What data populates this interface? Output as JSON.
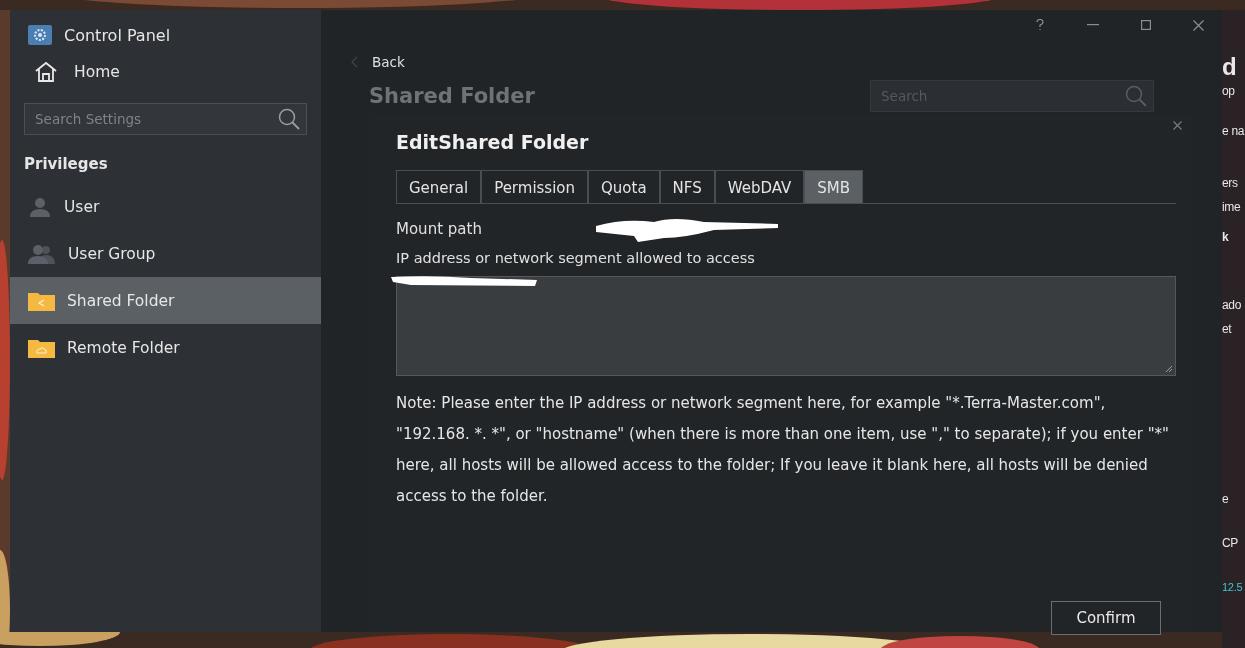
{
  "window": {
    "title": "Control Panel"
  },
  "sidebar": {
    "home": "Home",
    "search": {
      "placeholder": "Search Settings"
    },
    "section": "Privileges",
    "items": [
      {
        "label": "User",
        "selected": false
      },
      {
        "label": "User Group",
        "selected": false
      },
      {
        "label": "Shared Folder",
        "selected": true
      },
      {
        "label": "Remote Folder",
        "selected": false
      }
    ]
  },
  "main": {
    "back": "Back",
    "heading": "Shared Folder",
    "search": {
      "placeholder": "Search"
    }
  },
  "dialog": {
    "title": "EditShared Folder",
    "tabs": [
      {
        "label": "General",
        "selected": false
      },
      {
        "label": "Permission",
        "selected": false
      },
      {
        "label": "Quota",
        "selected": false
      },
      {
        "label": "NFS",
        "selected": false
      },
      {
        "label": "WebDAV",
        "selected": false
      },
      {
        "label": "SMB",
        "selected": true
      }
    ],
    "mount_path_label": "Mount path",
    "ip_label": "IP address or network segment allowed to access",
    "note": "Note: Please enter the IP address or network segment here, for example \"*.Terra-Master.com\", \"192.168. *. *\", or \"hostname\" (when there is more than one item, use \",\" to separate); if you enter \"*\" here, all hosts will be allowed access to the folder; If you leave it blank here, all hosts will be denied access to the folder.",
    "confirm": "Confirm"
  },
  "background_window_fragments": [
    "d",
    "op",
    "e na",
    "ers",
    "ime",
    "k",
    "ado",
    "et",
    "e",
    "CP",
    "12.5"
  ]
}
